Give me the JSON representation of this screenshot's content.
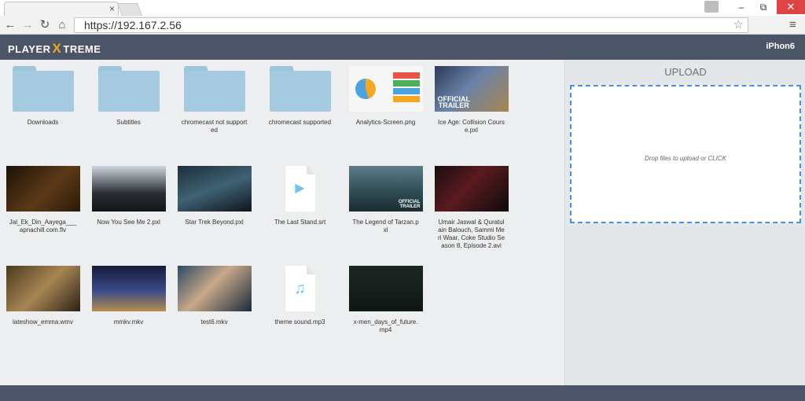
{
  "browser": {
    "tab_close": "×",
    "url": "https://192.167.2.56",
    "window": {
      "minimize": "–",
      "restore": "⧉",
      "close": "✕"
    }
  },
  "app": {
    "logo_left": "PLAYER",
    "logo_x": "X",
    "logo_right": "TREME",
    "device": "iPhon6"
  },
  "upload": {
    "title": "UPLOAD",
    "drop_text": "Drop files to upload or CLICK"
  },
  "thumb_text": {
    "ice_trailer": "OFFICIAL\nTRAILER",
    "tarzan_trailer": "OFFICIAL\nTRAILER"
  },
  "colors": {
    "header_bg": "#4c5567",
    "accent": "#f5a623",
    "dropzone_border": "#4a90e2",
    "folder": "#a5c9de"
  },
  "files": [
    {
      "name": "Downloads",
      "type": "folder"
    },
    {
      "name": "Subtitles",
      "type": "folder"
    },
    {
      "name": "chromecast not supported",
      "type": "folder"
    },
    {
      "name": "chromecast supported",
      "type": "folder"
    },
    {
      "name": "Analytics-Screen.png",
      "type": "image"
    },
    {
      "name": "Ice Age: Collision Course.pxl",
      "type": "video"
    },
    {
      "name": "Jal_Ek_Din_Aayega___apnachill.com.flv",
      "type": "video"
    },
    {
      "name": "Now You See Me 2.pxl",
      "type": "video"
    },
    {
      "name": "Star Trek Beyond.pxl",
      "type": "video"
    },
    {
      "name": "The Last Stand.srt",
      "type": "subtitle"
    },
    {
      "name": "The Legend of Tarzan.pxl",
      "type": "video"
    },
    {
      "name": "Umair Jaswal & Quratulain Balouch, Sammi Meri Waar, Coke Studio Season 8, Episode 2.avi",
      "type": "video"
    },
    {
      "name": "lateshow_emma.wmv",
      "type": "video"
    },
    {
      "name": "mmkv.mkv",
      "type": "video"
    },
    {
      "name": "test6.mkv",
      "type": "video"
    },
    {
      "name": "theme sound.mp3",
      "type": "audio"
    },
    {
      "name": "x-men_days_of_future.mp4",
      "type": "video"
    }
  ]
}
